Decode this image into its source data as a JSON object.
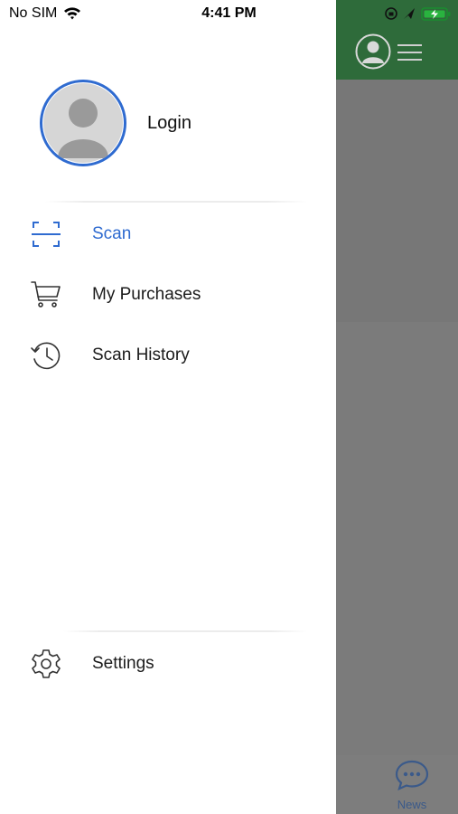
{
  "status_bar": {
    "carrier": "No SIM",
    "time": "4:41 PM"
  },
  "drawer": {
    "login_label": "Login",
    "menu_items": [
      {
        "label": "Scan",
        "icon": "scan-frame-icon",
        "active": true
      },
      {
        "label": "My Purchases",
        "icon": "cart-icon",
        "active": false
      },
      {
        "label": "Scan History",
        "icon": "history-clock-icon",
        "active": false
      }
    ],
    "settings_label": "Settings"
  },
  "background_app": {
    "tab_news_label": "News"
  },
  "colors": {
    "accent": "#2f6bd0",
    "header_green": "#2e6b3a",
    "overlay": "#7a7a7a"
  }
}
